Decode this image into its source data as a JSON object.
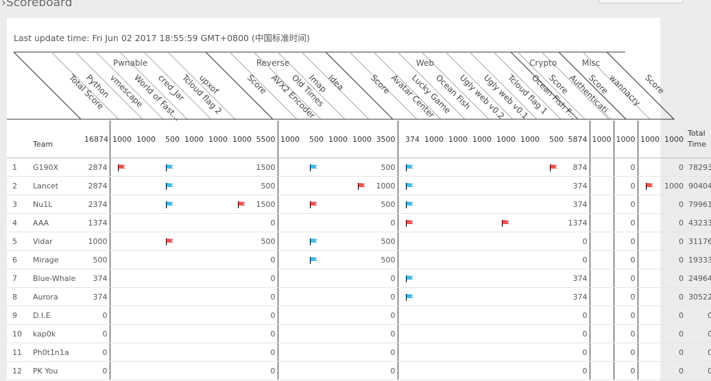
{
  "page": {
    "breadcrumb": "Scoreboard",
    "last_update": "Last update time: Fri Jun 02 2017 18:55:59 GMT+0800 (中国标准时间)"
  },
  "categories": [
    "Pwnable",
    "Reverse",
    "Web",
    "Crypto",
    "Misc"
  ],
  "diagonal_labels": [
    "Total Score",
    "Python",
    "vmescape",
    "World of Fast...",
    "cred_Jar",
    "Tcloud flag 2",
    "upxof",
    "Score",
    "AVX2 Encoder",
    "Old Times",
    "Imap",
    "Idea",
    "Score",
    "Avatar Center",
    "Lucky Game",
    "Ocean Fish",
    "Ugly web v0.2",
    "Ugly web v0.1",
    "Tcloud flag 1",
    "Ocean Fish F...",
    "Score",
    "Authenticati...",
    "Score",
    "wannacry",
    "Score"
  ],
  "header_row": {
    "team": "Team",
    "values": [
      "16874",
      "1000",
      "1000",
      "500",
      "1000",
      "1000",
      "1000",
      "5500",
      "1000",
      "500",
      "1000",
      "1000",
      "3500",
      "374",
      "1000",
      "1000",
      "1000",
      "1000",
      "1000",
      "500",
      "5874",
      "1000",
      "1000",
      "1000",
      "1000"
    ],
    "total_time": "Total Time"
  },
  "colors": {
    "red_flag": "#f05050",
    "blue_flag": "#3cbcec"
  },
  "rows": [
    {
      "rank": "1",
      "team": "G190X",
      "total": "2874",
      "pwn": "1500",
      "rev": "500",
      "web": "874",
      "crypto": "0",
      "misc": "0",
      "time": "78293",
      "flags": {
        "c1": "red",
        "c3": "blue",
        "c9": "blue",
        "c19": "red",
        "c13": "blue"
      }
    },
    {
      "rank": "2",
      "team": "Lancet",
      "total": "2874",
      "pwn": "500",
      "rev": "1000",
      "web": "374",
      "crypto": "0",
      "misc": "1000",
      "time": "90404",
      "flags": {
        "c3": "blue",
        "c11": "red",
        "c13": "blue",
        "c23": "red"
      }
    },
    {
      "rank": "3",
      "team": "Nu1L",
      "total": "2374",
      "pwn": "1500",
      "rev": "500",
      "web": "374",
      "crypto": "0",
      "misc": "0",
      "time": "79961",
      "flags": {
        "c3": "blue",
        "c6": "red",
        "c9": "red",
        "c13": "blue"
      }
    },
    {
      "rank": "4",
      "team": "AAA",
      "total": "1374",
      "pwn": "0",
      "rev": "0",
      "web": "1374",
      "crypto": "0",
      "misc": "0",
      "time": "43233",
      "flags": {
        "c13": "red",
        "c17": "red"
      }
    },
    {
      "rank": "5",
      "team": "Vidar",
      "total": "1000",
      "pwn": "500",
      "rev": "500",
      "web": "0",
      "crypto": "0",
      "misc": "0",
      "time": "31176",
      "flags": {
        "c3": "red",
        "c9": "blue"
      }
    },
    {
      "rank": "6",
      "team": "Mirage",
      "total": "500",
      "pwn": "0",
      "rev": "500",
      "web": "0",
      "crypto": "0",
      "misc": "0",
      "time": "19333",
      "flags": {
        "c9": "blue"
      }
    },
    {
      "rank": "7",
      "team": "Blue-Whale",
      "total": "374",
      "pwn": "0",
      "rev": "0",
      "web": "374",
      "crypto": "0",
      "misc": "0",
      "time": "24964",
      "flags": {
        "c13": "blue"
      }
    },
    {
      "rank": "8",
      "team": "Aurora",
      "total": "374",
      "pwn": "0",
      "rev": "0",
      "web": "374",
      "crypto": "0",
      "misc": "0",
      "time": "30522",
      "flags": {
        "c13": "blue"
      }
    },
    {
      "rank": "9",
      "team": "D.I.E",
      "total": "0",
      "pwn": "0",
      "rev": "0",
      "web": "0",
      "crypto": "0",
      "misc": "0",
      "time": "0",
      "flags": {}
    },
    {
      "rank": "10",
      "team": "kap0k",
      "total": "0",
      "pwn": "0",
      "rev": "0",
      "web": "0",
      "crypto": "0",
      "misc": "0",
      "time": "0",
      "flags": {}
    },
    {
      "rank": "11",
      "team": "Ph0t1n1a",
      "total": "0",
      "pwn": "0",
      "rev": "0",
      "web": "0",
      "crypto": "0",
      "misc": "0",
      "time": "0",
      "flags": {}
    },
    {
      "rank": "12",
      "team": "PK You",
      "total": "0",
      "pwn": "0",
      "rev": "0",
      "web": "0",
      "crypto": "0",
      "misc": "0",
      "time": "0",
      "flags": {}
    }
  ]
}
